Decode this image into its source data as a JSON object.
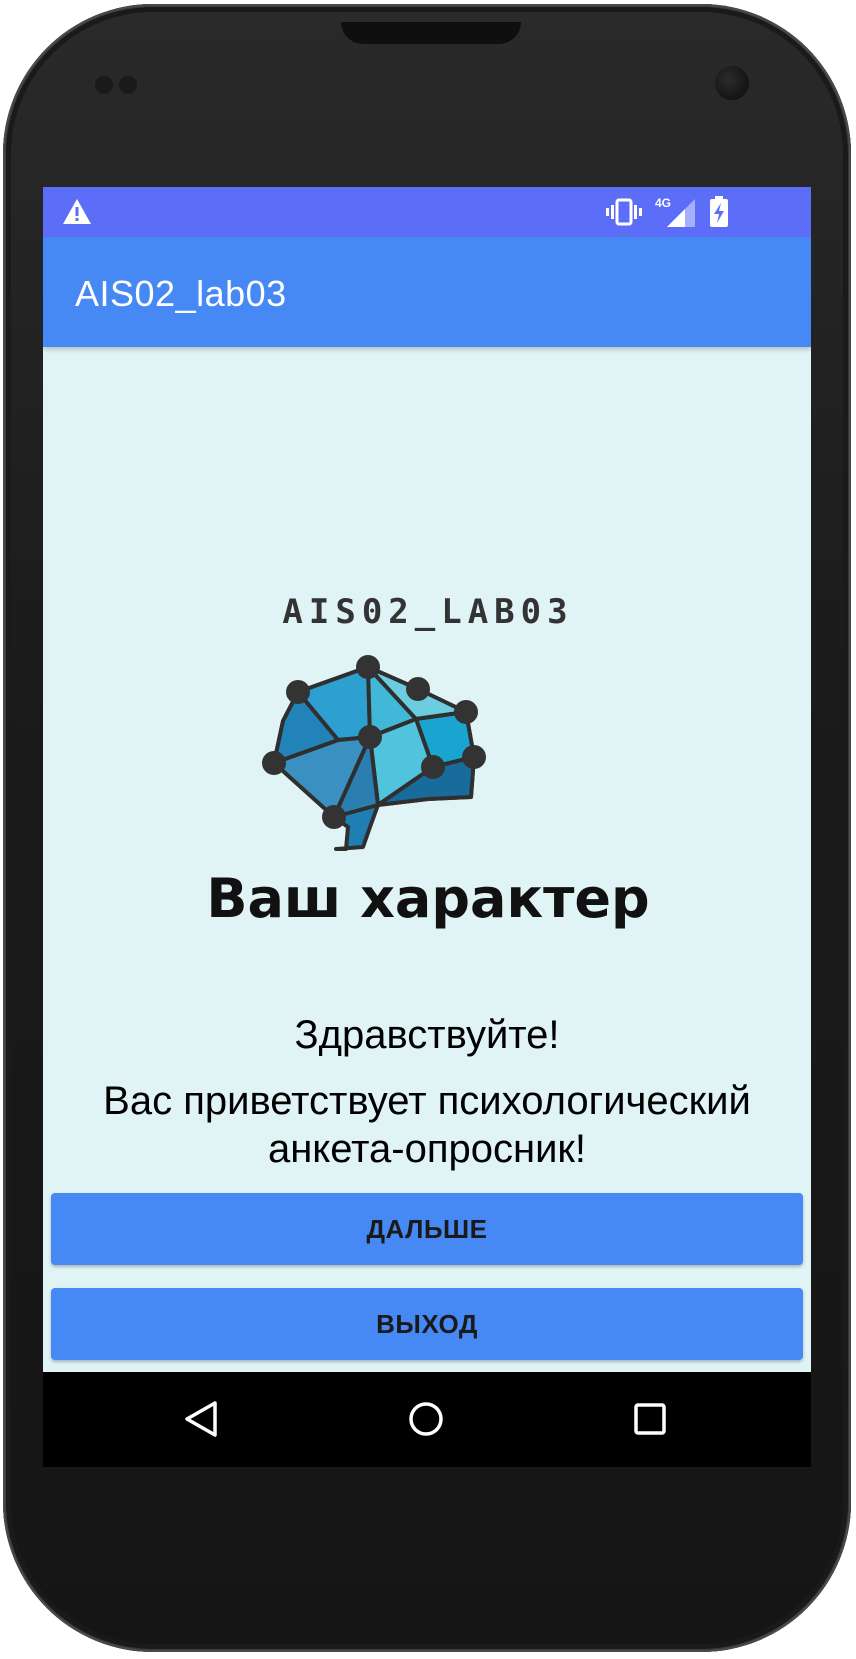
{
  "status_bar": {
    "icons": [
      "warning-icon",
      "vibrate-icon",
      "signal-4g-icon",
      "battery-charging-icon"
    ],
    "network_label": "4G",
    "color": "#5c6ef8"
  },
  "app_bar": {
    "title": "AIS02_lab03",
    "color": "#4689f5"
  },
  "logo": {
    "heading": "AIS02_LAB03",
    "caption": "Ваш характер",
    "icon": "brain-network-icon"
  },
  "main": {
    "greeting": "Здравствуйте!",
    "welcome": "Вас приветствует психологический\nанкета-опросник!",
    "background": "#e0f4f6"
  },
  "buttons": {
    "next_label": "ДАЛЬШЕ",
    "exit_label": "ВЫХОД",
    "color": "#4689f5"
  },
  "nav_bar": {
    "icons": [
      "back-icon",
      "home-icon",
      "recent-apps-icon"
    ]
  }
}
